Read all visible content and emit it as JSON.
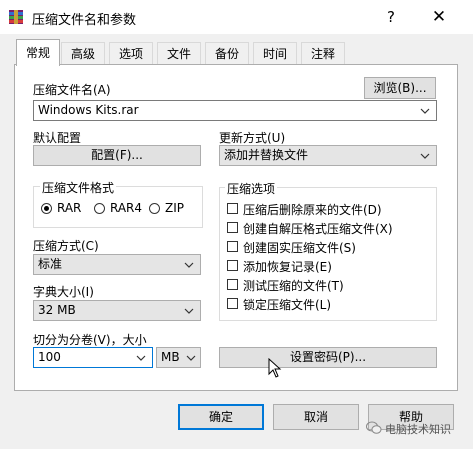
{
  "window": {
    "title": "压缩文件名和参数",
    "help_label": "?",
    "close_label": "✕"
  },
  "tabs": [
    {
      "label": "常规",
      "active": true
    },
    {
      "label": "高级"
    },
    {
      "label": "选项"
    },
    {
      "label": "文件"
    },
    {
      "label": "备份"
    },
    {
      "label": "时间"
    },
    {
      "label": "注释"
    }
  ],
  "archive_name": {
    "label": "压缩文件名(A)",
    "value": "Windows Kits.rar",
    "browse_label": "浏览(B)..."
  },
  "default_config": {
    "label": "默认配置",
    "button_label": "配置(F)..."
  },
  "update_mode": {
    "label": "更新方式(U)",
    "value": "添加并替换文件"
  },
  "archive_format": {
    "label": "压缩文件格式",
    "options": [
      "RAR",
      "RAR4",
      "ZIP"
    ],
    "selected": "RAR"
  },
  "compression_method": {
    "label": "压缩方式(C)",
    "value": "标准"
  },
  "dictionary_size": {
    "label": "字典大小(I)",
    "value": "32 MB"
  },
  "split_volumes": {
    "label": "切分为分卷(V)，大小",
    "value": "100",
    "unit": "MB"
  },
  "archive_options": {
    "label": "压缩选项",
    "items": [
      {
        "label": "压缩后删除原来的文件(D)",
        "checked": false
      },
      {
        "label": "创建自解压格式压缩文件(X)",
        "checked": false
      },
      {
        "label": "创建固实压缩文件(S)",
        "checked": false
      },
      {
        "label": "添加恢复记录(E)",
        "checked": false
      },
      {
        "label": "测试压缩的文件(T)",
        "checked": false
      },
      {
        "label": "锁定压缩文件(L)",
        "checked": false
      }
    ]
  },
  "set_password_label": "设置密码(P)...",
  "buttons": {
    "ok": "确定",
    "cancel": "取消",
    "help": "帮助"
  },
  "watermark": "电脑技术知识"
}
